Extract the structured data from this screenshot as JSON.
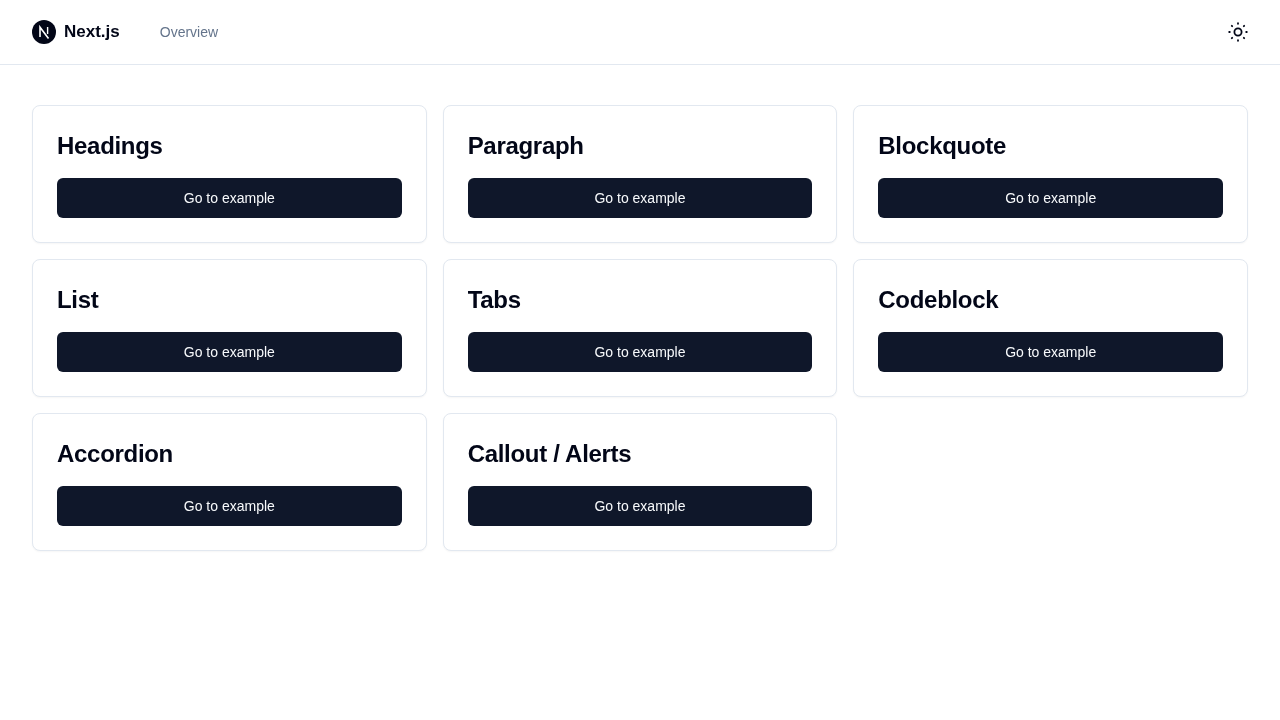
{
  "header": {
    "brand": "Next.js",
    "nav_links": [
      {
        "label": "Overview"
      }
    ]
  },
  "cards": [
    {
      "title": "Headings",
      "button": "Go to example"
    },
    {
      "title": "Paragraph",
      "button": "Go to example"
    },
    {
      "title": "Blockquote",
      "button": "Go to example"
    },
    {
      "title": "List",
      "button": "Go to example"
    },
    {
      "title": "Tabs",
      "button": "Go to example"
    },
    {
      "title": "Codeblock",
      "button": "Go to example"
    },
    {
      "title": "Accordion",
      "button": "Go to example"
    },
    {
      "title": "Callout / Alerts",
      "button": "Go to example"
    }
  ]
}
